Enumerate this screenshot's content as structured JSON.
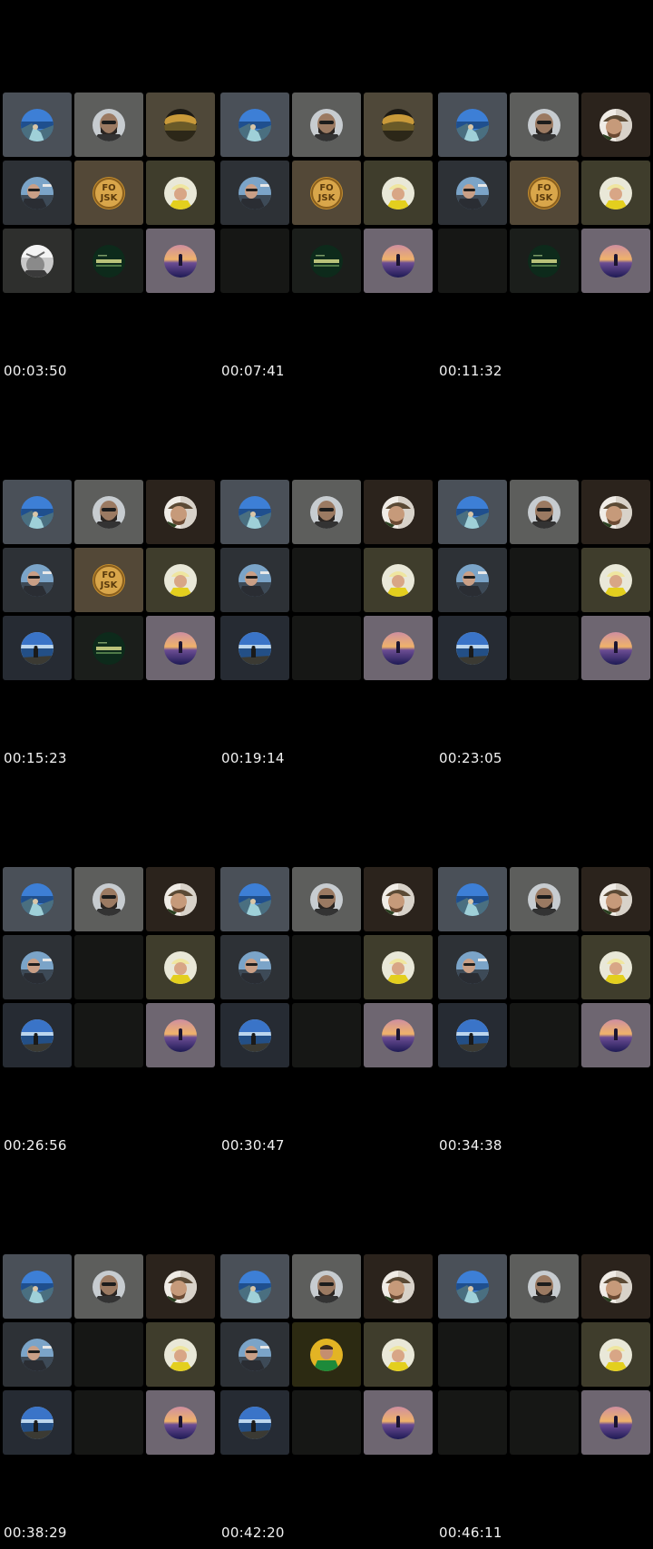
{
  "frames": [
    {
      "timestamp": "00:03:50",
      "tiles": [
        "coast",
        "beard",
        "landscape",
        "selfie",
        "fojsk",
        "yellowcap",
        "bwface",
        "greenlogo",
        "sunset"
      ]
    },
    {
      "timestamp": "00:07:41",
      "tiles": [
        "coast",
        "beard",
        "landscape",
        "selfie",
        "fojsk",
        "yellowcap",
        "empty",
        "greenlogo",
        "sunset"
      ]
    },
    {
      "timestamp": "00:11:32",
      "tiles": [
        "coast",
        "beard",
        "hat",
        "selfie",
        "fojsk",
        "yellowcap",
        "empty",
        "greenlogo",
        "sunset"
      ]
    },
    {
      "timestamp": "00:15:23",
      "tiles": [
        "coast",
        "beard",
        "hat",
        "selfie",
        "fojsk",
        "yellowcap",
        "sea",
        "greenlogo",
        "sunset"
      ]
    },
    {
      "timestamp": "00:19:14",
      "tiles": [
        "coast",
        "beard",
        "hat",
        "selfie",
        "empty",
        "yellowcap",
        "sea",
        "empty",
        "sunset"
      ]
    },
    {
      "timestamp": "00:23:05",
      "tiles": [
        "coast",
        "beard",
        "hat",
        "selfie",
        "empty",
        "yellowcap",
        "sea",
        "empty",
        "sunset"
      ]
    },
    {
      "timestamp": "00:26:56",
      "tiles": [
        "coast",
        "beard",
        "hat",
        "selfie",
        "empty",
        "yellowcap",
        "sea",
        "empty",
        "sunset"
      ]
    },
    {
      "timestamp": "00:30:47",
      "tiles": [
        "coast",
        "beard",
        "hat",
        "selfie",
        "empty",
        "yellowcap",
        "sea",
        "empty",
        "sunset"
      ]
    },
    {
      "timestamp": "00:34:38",
      "tiles": [
        "coast",
        "beard",
        "hat",
        "selfie",
        "empty",
        "yellowcap",
        "sea",
        "empty",
        "sunset"
      ]
    },
    {
      "timestamp": "00:38:29",
      "tiles": [
        "coast",
        "beard",
        "hat",
        "selfie",
        "empty",
        "yellowcap",
        "sea",
        "empty",
        "sunset"
      ]
    },
    {
      "timestamp": "00:42:20",
      "tiles": [
        "coast",
        "beard",
        "hat",
        "selfie",
        "greenshirt",
        "yellowcap",
        "sea",
        "empty",
        "sunset"
      ]
    },
    {
      "timestamp": "00:46:11",
      "tiles": [
        "coast",
        "beard",
        "hat",
        "empty",
        "empty",
        "yellowcap",
        "empty",
        "empty",
        "sunset"
      ]
    }
  ],
  "participants": {
    "coast": {
      "icon": "coast-photo-avatar",
      "tile_bg": "#4a5058"
    },
    "beard": {
      "icon": "bearded-man-avatar",
      "tile_bg": "#5d5e5c"
    },
    "landscape": {
      "icon": "golden-landscape-avatar",
      "tile_bg": "#4f4839"
    },
    "hat": {
      "icon": "man-with-hat-avatar",
      "tile_bg": "#2b231c"
    },
    "selfie": {
      "icon": "selfie-man-avatar",
      "tile_bg": "#2d3136"
    },
    "fojsk": {
      "icon": "fojsk-logo-avatar",
      "tile_bg": "#534837",
      "label_top": "FO",
      "label_bottom": "JSK"
    },
    "yellowcap": {
      "icon": "yellow-cap-man-avatar",
      "tile_bg": "#3f3d2c"
    },
    "bwface": {
      "icon": "monochrome-face-avatar",
      "tile_bg": "#2e2f2d"
    },
    "greenlogo": {
      "icon": "green-logo-avatar",
      "tile_bg": "#1b1e1b"
    },
    "sunset": {
      "icon": "sunset-silhouette-avatar",
      "tile_bg": "#6e6671"
    },
    "sea": {
      "icon": "sea-horizon-avatar",
      "tile_bg": "#262b33"
    },
    "greenshirt": {
      "icon": "man-green-shirt-avatar",
      "tile_bg": "#2c2a12"
    },
    "empty": {
      "icon": "",
      "tile_bg": "#161715"
    }
  }
}
